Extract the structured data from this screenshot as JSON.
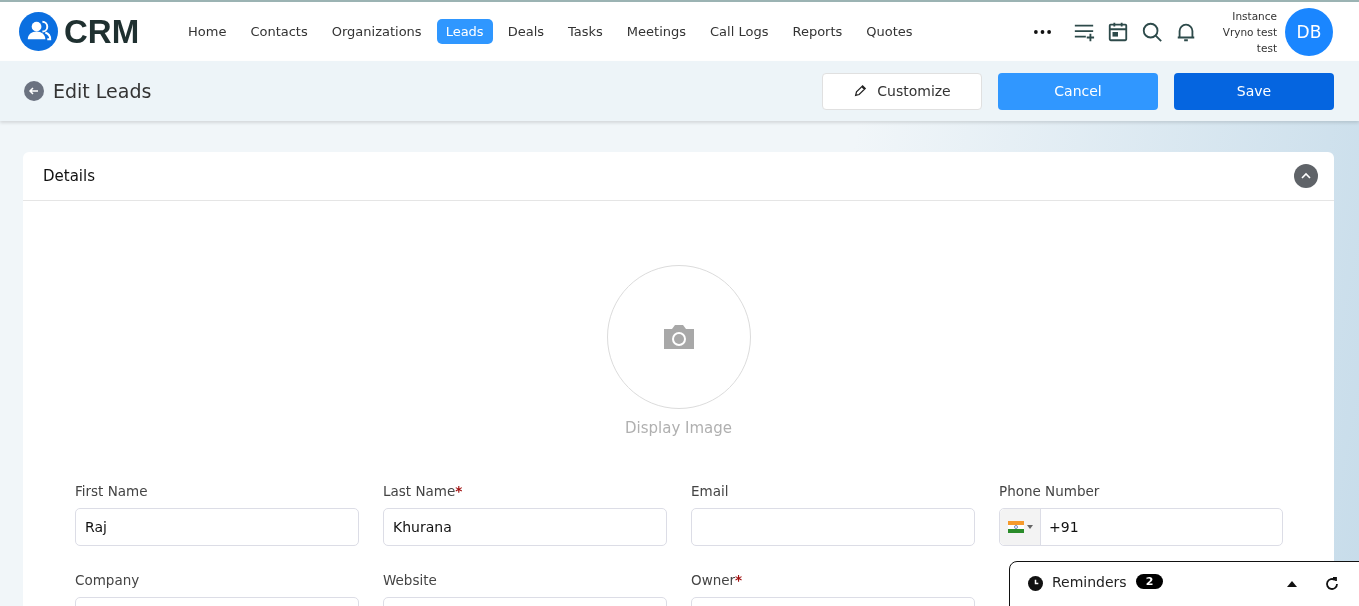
{
  "brand": {
    "name": "CRM"
  },
  "nav": [
    {
      "label": "Home",
      "selected": false
    },
    {
      "label": "Contacts",
      "selected": false
    },
    {
      "label": "Organizations",
      "selected": false
    },
    {
      "label": "Leads",
      "selected": true
    },
    {
      "label": "Deals",
      "selected": false
    },
    {
      "label": "Tasks",
      "selected": false
    },
    {
      "label": "Meetings",
      "selected": false
    },
    {
      "label": "Call Logs",
      "selected": false
    },
    {
      "label": "Reports",
      "selected": false
    },
    {
      "label": "Quotes",
      "selected": false
    }
  ],
  "user": {
    "lines": [
      "Instance",
      "Vryno test",
      "test"
    ],
    "initials": "DB"
  },
  "page": {
    "title": "Edit Leads",
    "buttons": [
      {
        "label": "Customize",
        "kind": "outline"
      },
      {
        "label": "Cancel",
        "kind": "secondary"
      },
      {
        "label": "Save",
        "kind": "primary"
      }
    ]
  },
  "section": {
    "title": "Details",
    "expanded": true,
    "image_label": "Display Image"
  },
  "fields": [
    {
      "label": "First Name",
      "kind": "text",
      "value": "Raj"
    },
    {
      "label": "Last Name",
      "required_mark": "*",
      "kind": "text",
      "value": "Khurana"
    },
    {
      "label": "Email",
      "kind": "text"
    },
    {
      "label": "Phone Number",
      "kind": "phone",
      "value": "+91"
    },
    {
      "label": "Company",
      "kind": "text"
    },
    {
      "label": "Website",
      "kind": "text"
    },
    {
      "label": "Owner",
      "required_mark": "*",
      "kind": "text"
    }
  ],
  "reminders": {
    "title": "Reminders",
    "count": "2"
  }
}
